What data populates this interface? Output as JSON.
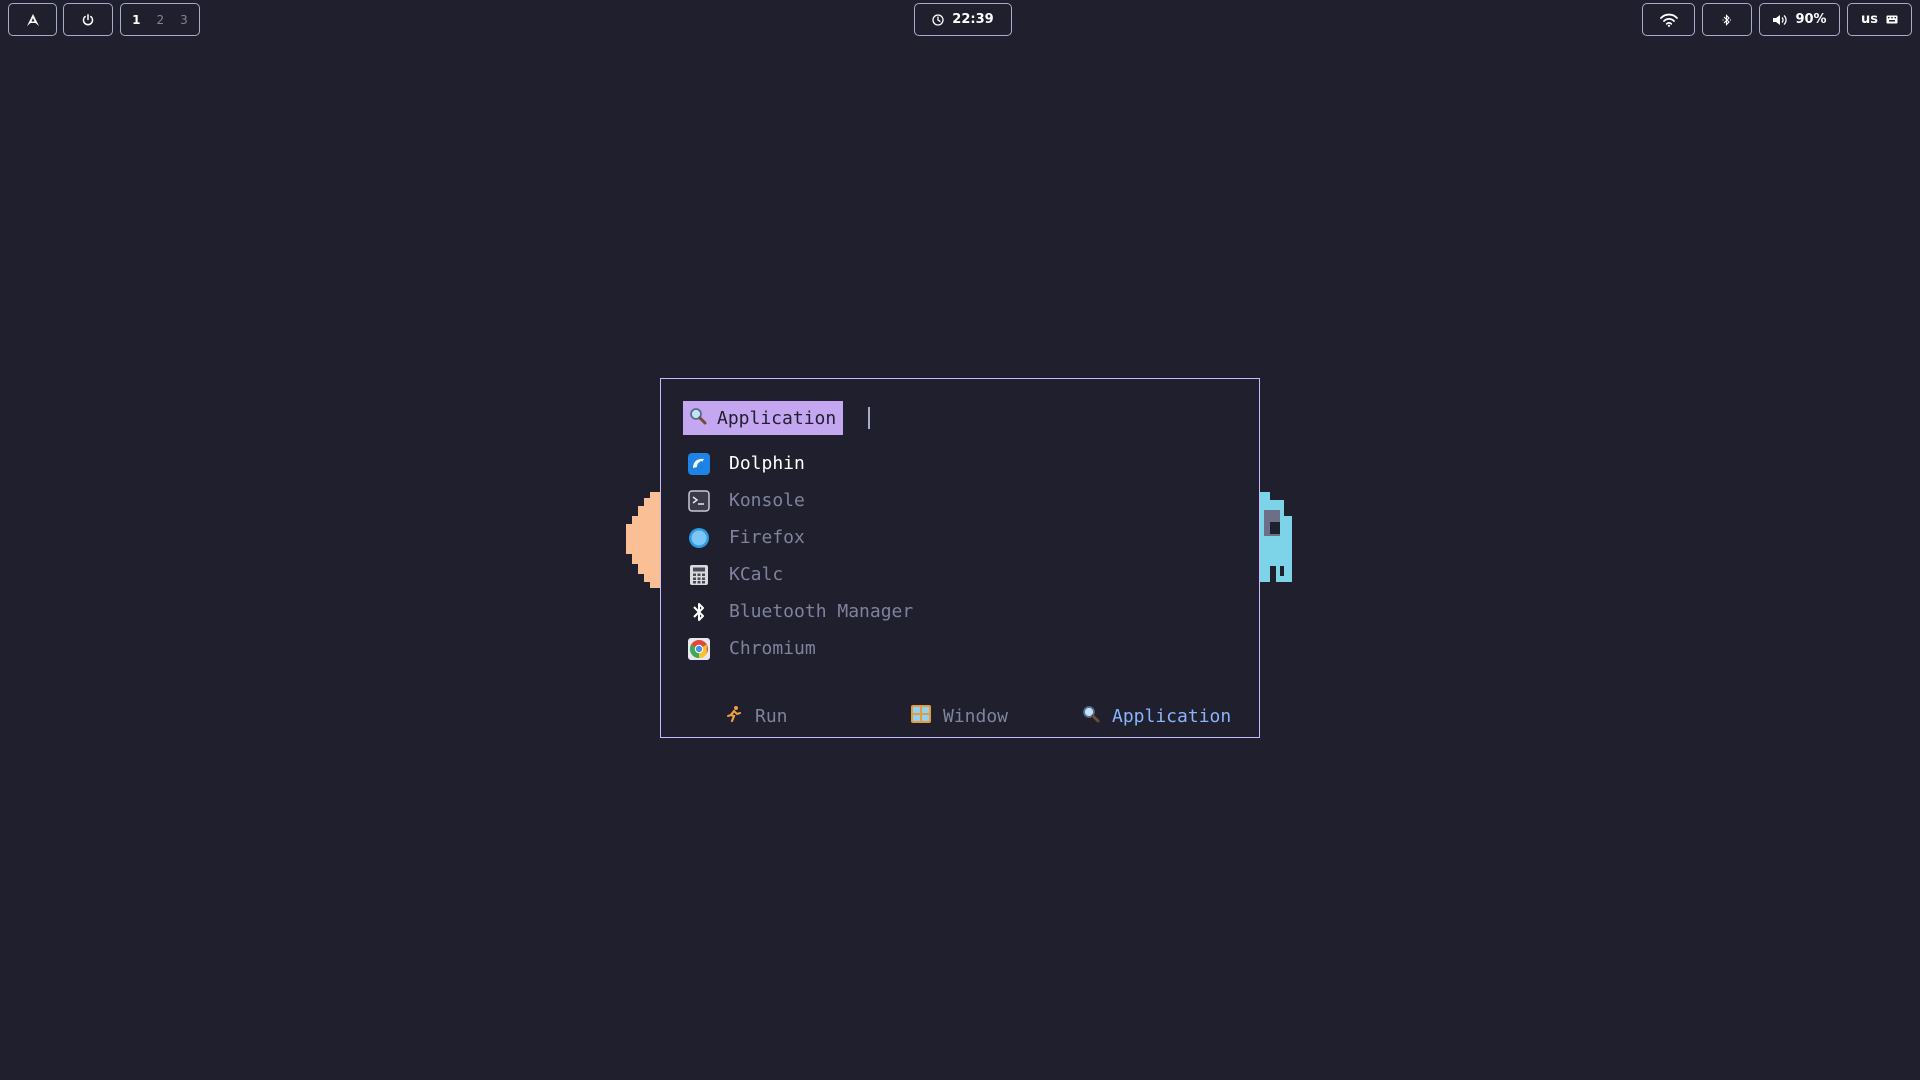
{
  "topbar": {
    "launcher_icon": "arch-logo-icon",
    "power_icon": "power-icon",
    "workspaces": [
      "1",
      "2",
      "3"
    ],
    "active_workspace": "1",
    "clock_icon": "clock-icon",
    "clock": "22:39",
    "wifi_icon": "wifi-icon",
    "bluetooth_icon": "bluetooth-icon",
    "volume_icon": "volume-icon",
    "volume": "90%",
    "keyboard_layout": "us",
    "keyboard_icon": "keyboard-icon"
  },
  "launcher": {
    "mode_label": "Application",
    "mode_icon": "search-icon",
    "query": "",
    "items": [
      {
        "label": "Dolphin",
        "icon": "dolphin-icon",
        "selected": true
      },
      {
        "label": "Konsole",
        "icon": "terminal-icon",
        "selected": false
      },
      {
        "label": "Firefox",
        "icon": "browser-icon",
        "selected": false
      },
      {
        "label": "KCalc",
        "icon": "calculator-icon",
        "selected": false
      },
      {
        "label": "Bluetooth Manager",
        "icon": "bluetooth-icon",
        "selected": false
      },
      {
        "label": "Chromium",
        "icon": "chromium-icon",
        "selected": false
      }
    ],
    "modes": [
      {
        "label": "Run",
        "icon": "runner-icon",
        "active": false
      },
      {
        "label": "Window",
        "icon": "window-icon",
        "active": false
      },
      {
        "label": "Application",
        "icon": "search-icon",
        "active": true
      }
    ]
  },
  "colors": {
    "background": "#1f1f2e",
    "accent": "#c4a7f0",
    "active_mode": "#89b4fa",
    "deco_left": "#fbbf96",
    "deco_right": "#7dd3e8"
  }
}
